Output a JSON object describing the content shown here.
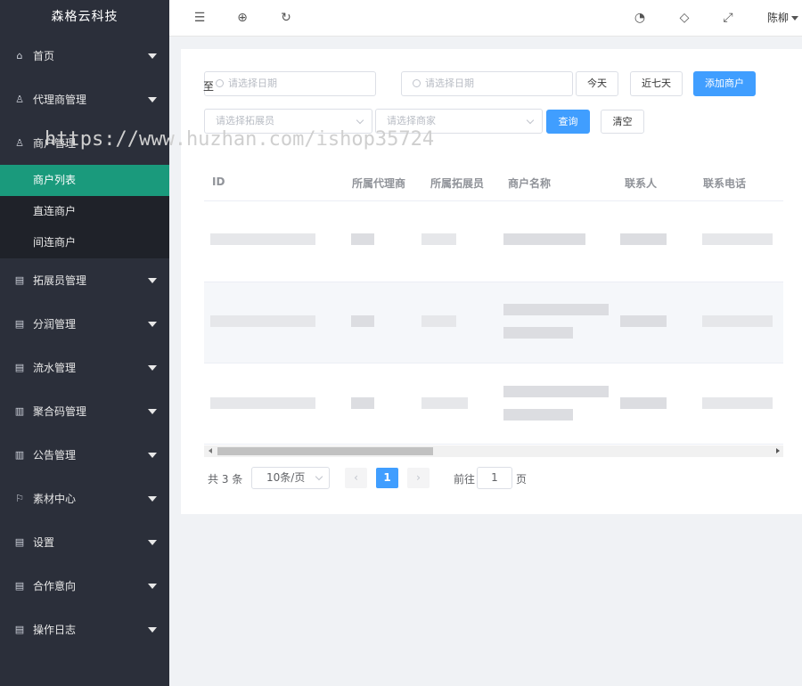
{
  "brand": "森格云科技",
  "sidebar": {
    "items": [
      {
        "label": "首页",
        "icon": "home-icon"
      },
      {
        "label": "代理商管理",
        "icon": "user-icon"
      },
      {
        "label": "商户管理",
        "icon": "user-icon"
      },
      {
        "label": "拓展员管理",
        "icon": "clipboard-icon"
      },
      {
        "label": "分润管理",
        "icon": "clipboard-icon"
      },
      {
        "label": "流水管理",
        "icon": "clipboard-icon"
      },
      {
        "label": "聚合码管理",
        "icon": "book-icon"
      },
      {
        "label": "公告管理",
        "icon": "book-icon"
      },
      {
        "label": "素材中心",
        "icon": "flag-icon"
      },
      {
        "label": "设置",
        "icon": "clipboard-icon"
      },
      {
        "label": "合作意向",
        "icon": "clipboard-icon"
      },
      {
        "label": "操作日志",
        "icon": "clipboard-icon"
      }
    ],
    "submenu": [
      {
        "label": "商户列表",
        "active": true
      },
      {
        "label": "直连商户",
        "active": false
      },
      {
        "label": "间连商户",
        "active": false
      }
    ],
    "active_color": "#1a9a7c",
    "background": "#2b2f3a"
  },
  "header": {
    "icons": [
      "menu-fold-icon",
      "globe-icon",
      "refresh-icon",
      "palette-icon",
      "tag-icon",
      "fullscreen-icon"
    ],
    "user": "陈柳"
  },
  "filters": {
    "date_start_placeholder": "请选择日期",
    "date_to": "至",
    "date_end_placeholder": "请选择日期",
    "today_label": "今天",
    "last7_label": "近七天",
    "add_label": "添加商户",
    "promoter_placeholder": "请选择拓展员",
    "merchant_placeholder": "请选择商家",
    "search_label": "查询",
    "clear_label": "清空"
  },
  "table": {
    "columns": [
      "ID",
      "所属代理商",
      "所属拓展员",
      "商户名称",
      "联系人",
      "联系电话"
    ],
    "rows": 3
  },
  "pagination": {
    "total": "共 3 条",
    "page_size": "10条/页",
    "current_page": "1",
    "goto_label": "前往",
    "goto_value": "1",
    "page_suffix": "页"
  },
  "watermark": "https://www.huzhan.com/ishop35724"
}
